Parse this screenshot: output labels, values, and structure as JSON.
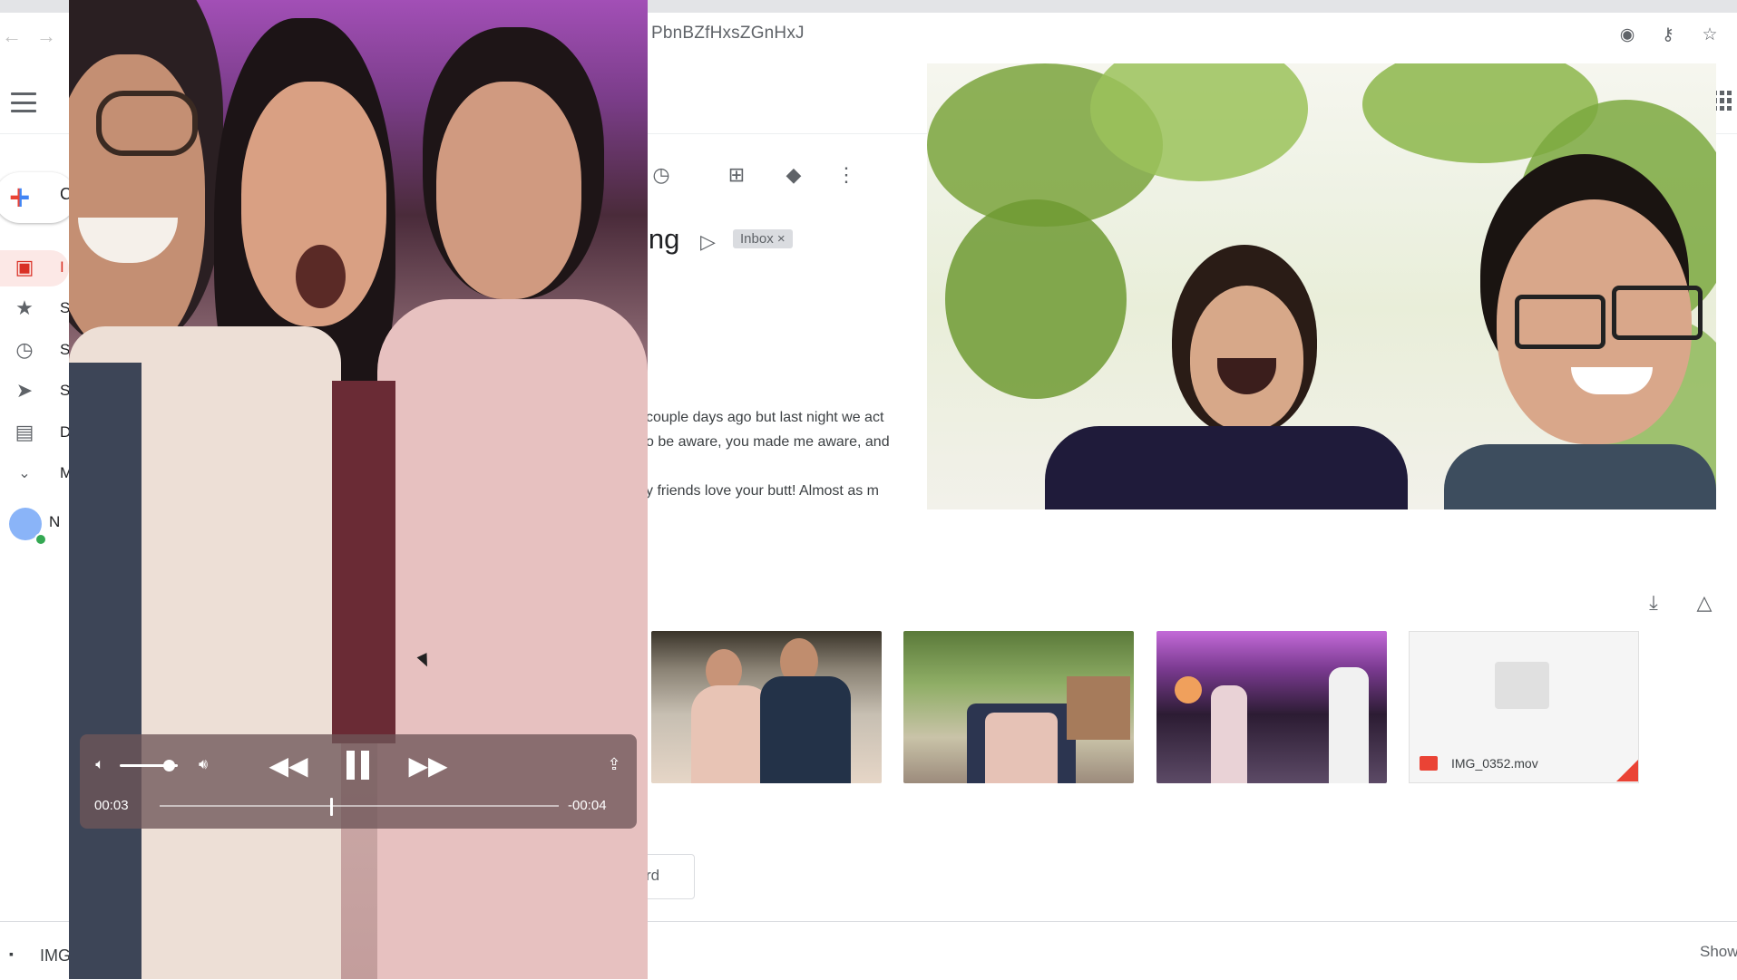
{
  "browser": {
    "url_fragment": "PbnBZfHxsZGnHxJ",
    "icons": [
      "back-icon",
      "forward-icon",
      "eye-icon",
      "key-icon",
      "star-icon"
    ]
  },
  "gmail": {
    "sidebar": {
      "compose_label": "C",
      "items": [
        {
          "icon": "inbox-icon",
          "label": "I"
        },
        {
          "icon": "star-icon",
          "label": "S"
        },
        {
          "icon": "clock-icon",
          "label": "S"
        },
        {
          "icon": "send-icon",
          "label": "S"
        },
        {
          "icon": "draft-icon",
          "label": "D"
        },
        {
          "icon": "chevron-down-icon",
          "label": "M"
        }
      ],
      "user_label": "N"
    },
    "toolbar_icons": [
      "snooze-icon",
      "move-to-icon",
      "label-icon",
      "more-icon"
    ],
    "subject": "ing",
    "label_badge": "Inbox ×",
    "body_lines": [
      "couple days ago but last night we act",
      "o be aware, you made me aware, and",
      "y friends love your butt! Almost as m"
    ],
    "attachment_file": "IMG_0352.mov",
    "forward_label": "rd",
    "apps_icon": "apps-grid-icon"
  },
  "downloads": {
    "item_label": "IMG",
    "show_all": "Show"
  },
  "video_player": {
    "elapsed": "00:03",
    "remaining": "-00:04",
    "progress": 0.43,
    "volume": 0.85,
    "state": "playing"
  },
  "colors": {
    "accent_red": "#ea4335",
    "inbox_highlight": "#fce8e6",
    "player_overlay": "#6e5658"
  }
}
